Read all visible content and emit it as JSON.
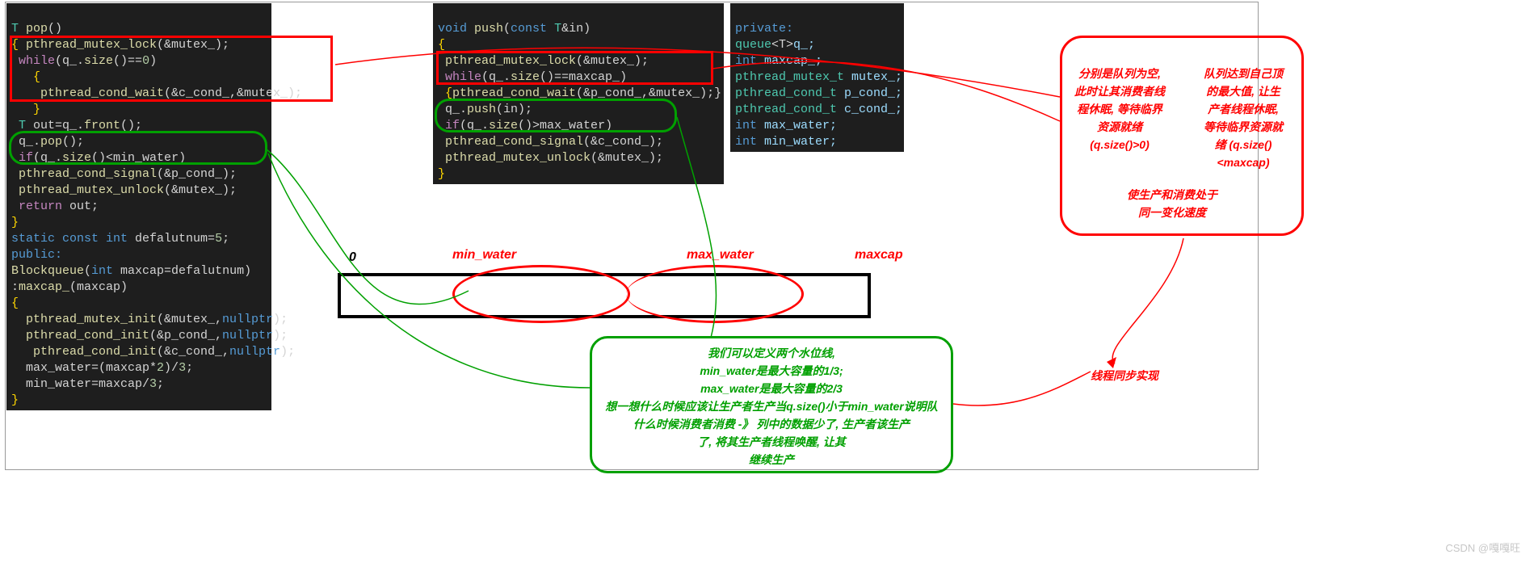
{
  "code1": {
    "l1a": "T",
    "l1b": " pop",
    "l1c": "()",
    "l2a": "{",
    "l2b": " pthread_mutex_lock",
    "l2c": "(&mutex_);",
    "l3a": " while",
    "l3b": "(q_.",
    "l3c": "size",
    "l3d": "()==",
    "l3e": "0",
    "l3f": ")",
    "l4": "   {",
    "l5a": "    pthread_cond_wait",
    "l5b": "(&c_cond_,&mutex_);",
    "l6": "   }",
    "l7a": " T",
    "l7b": " out=q_.",
    "l7c": "front",
    "l7d": "();",
    "l8a": " q_.",
    "l8b": "pop",
    "l8c": "();",
    "l9a": " if",
    "l9b": "(q_.",
    "l9c": "size",
    "l9d": "()<min_water)",
    "l10a": " pthread_cond_signal",
    "l10b": "(&p_cond_);",
    "l11a": " pthread_mutex_unlock",
    "l11b": "(&mutex_);",
    "l12a": " return",
    "l12b": " out;",
    "l13": "}",
    "l14a": "static const int",
    "l14b": " defalutnum=",
    "l14c": "5",
    "l14d": ";",
    "l15": "public:",
    "l16a": "Blockqueue",
    "l16b": "(",
    "l16c": "int",
    "l16d": " maxcap=defalutnum)",
    "l17a": ":",
    "l17b": "maxcap_",
    "l17c": "(maxcap)",
    "l18": "{",
    "l19a": "  pthread_mutex_init",
    "l19b": "(&mutex_,",
    "l19c": "nullptr",
    "l19d": ");",
    "l20a": "  pthread_cond_init",
    "l20b": "(&p_cond_,",
    "l20c": "nullptr",
    "l20d": ");",
    "l21a": "   pthread_cond_init",
    "l21b": "(&c_cond_,",
    "l21c": "nullptr",
    "l21d": ");",
    "l22a": "  max_water=(maxcap*",
    "l22b": "2",
    "l22c": ")/",
    "l22d": "3",
    "l22e": ";",
    "l23a": "  min_water=maxcap/",
    "l23b": "3",
    "l23c": ";",
    "l24": "}"
  },
  "code2": {
    "l1a": "void",
    "l1b": " push",
    "l1c": "(",
    "l1d": "const",
    "l1e": " T",
    "l1f": "&in)",
    "l2": "{",
    "l3a": " pthread_mutex_lock",
    "l3b": "(&mutex_);",
    "l4a": " while",
    "l4b": "(q_.",
    "l4c": "size",
    "l4d": "()==maxcap_)",
    "l5a": " {",
    "l5b": "pthread_cond_wait",
    "l5c": "(&p_cond_,&mutex_);}",
    "l6a": " q_.",
    "l6b": "push",
    "l6c": "(in);",
    "l7a": " if",
    "l7b": "(q_.",
    "l7c": "size",
    "l7d": "()>max_water)",
    "l8a": " pthread_cond_signal",
    "l8b": "(&c_cond_);",
    "l9a": " pthread_mutex_unlock",
    "l9b": "(&mutex_);",
    "l10": "}"
  },
  "code3": {
    "l1": "private:",
    "l2a": "queue",
    "l2b": "<T>",
    "l2c": "q_;",
    "l3a": "int",
    "l3b": " maxcap_;",
    "l4a": "pthread_mutex_t",
    "l4b": " mutex_;",
    "l5a": "pthread_cond_t",
    "l5b": " p_cond_;",
    "l6a": "pthread_cond_t",
    "l6b": " c_cond_;",
    "l7a": "int",
    "l7b": " max_water;",
    "l8a": "int",
    "l8b": " min_water;"
  },
  "labels": {
    "zero": "0",
    "minw": "min_water",
    "maxw": "max_water",
    "maxcap": "maxcap"
  },
  "red_box": {
    "l1": "分别是队列为空,",
    "l2": "此时让其消费者线",
    "l3": "程休眠, 等待临界",
    "l4": "资源就绪",
    "l5": "(q.size()>0)",
    "r1": "队列达到自己顶",
    "r2": "的最大值, 让生",
    "r3": "产者线程休眠,",
    "r4": "等待临界资源就",
    "r5": "绪 (q.size()",
    "r6": "<maxcap)",
    "c1": "使生产和消费处于",
    "c2": "同一变化速度"
  },
  "green_box": {
    "g1": "我们可以定义两个水位线,",
    "g2": "min_water是最大容量的1/3;",
    "g3": "max_water是最大容量的2/3",
    "g4": "想一想什么时候应该让生产者生产当q.size()小于min_water说明队",
    "g5": "什么时候消费者消费   -》  列中的数据少了, 生产者该生产",
    "g6": "了, 将其生产者线程唤醒, 让其",
    "g7": "继续生产"
  },
  "sync_label": "线程同步实现",
  "watermark": "CSDN @嘎嘎旺"
}
